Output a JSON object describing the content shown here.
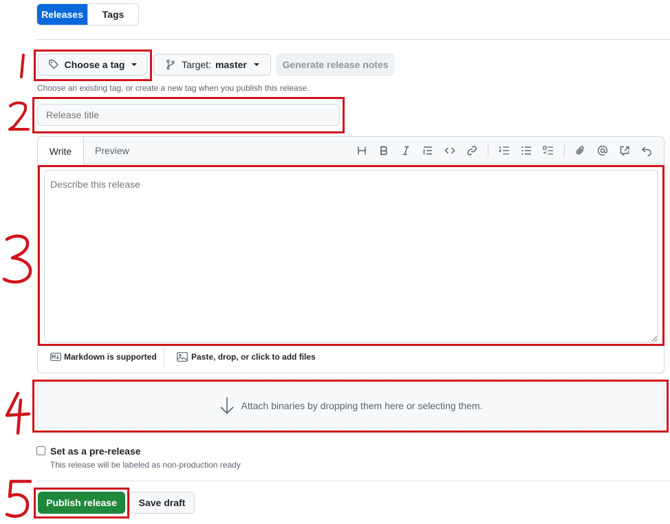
{
  "tabs": {
    "releases": "Releases",
    "tags": "Tags"
  },
  "tag_picker": {
    "label": "Choose a tag"
  },
  "target": {
    "label": "Target:",
    "branch": "master"
  },
  "generate_notes": {
    "label": "Generate release notes"
  },
  "tag_hint": "Choose an existing tag, or create a new tag when you publish this release.",
  "title_input": {
    "placeholder": "Release title"
  },
  "editor": {
    "write_tab": "Write",
    "preview_tab": "Preview",
    "placeholder": "Describe this release",
    "markdown_note": "Markdown is supported",
    "attach_note": "Paste, drop, or click to add files"
  },
  "toolbar_icons": [
    "heading-icon",
    "bold-icon",
    "italic-icon",
    "quote-icon",
    "code-icon",
    "link-icon",
    "ordered-list-icon",
    "unordered-list-icon",
    "task-list-icon",
    "attach-icon",
    "mention-icon",
    "reference-icon",
    "undo-icon"
  ],
  "binaries": {
    "label": "Attach binaries by dropping them here or selecting them."
  },
  "prerelease": {
    "label": "Set as a pre-release",
    "hint": "This release will be labeled as non-production ready",
    "checked": false
  },
  "actions": {
    "publish": "Publish release",
    "save_draft": "Save draft"
  },
  "annotations": [
    "1",
    "2",
    "3",
    "4",
    "5"
  ],
  "colors": {
    "primary": "#0969da",
    "publish": "#1f883d",
    "annotation": "#d0141c"
  }
}
